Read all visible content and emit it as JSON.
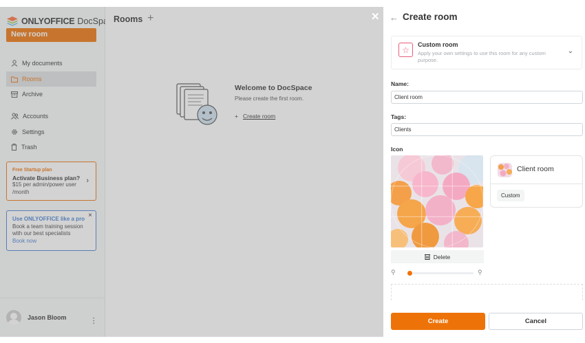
{
  "sidebar": {
    "logo": {
      "brand": "ONLYOFFICE",
      "product": "DocSpace"
    },
    "new_room_label": "New room",
    "items": [
      {
        "label": "My documents",
        "icon": "user-icon"
      },
      {
        "label": "Rooms",
        "icon": "folder-icon",
        "active": true
      },
      {
        "label": "Archive",
        "icon": "archive-icon"
      },
      {
        "label": "Accounts",
        "icon": "users-icon"
      },
      {
        "label": "Settings",
        "icon": "gear-icon"
      },
      {
        "label": "Trash",
        "icon": "trash-icon"
      }
    ],
    "promo_business": {
      "badge": "Free Startup plan",
      "title": "Activate Business plan?",
      "text": "$15 per admin/power user /month"
    },
    "promo_training": {
      "title": "Use ONLYOFFICE like a pro",
      "text": "Book a team training session with our best specialists",
      "link": "Book now"
    },
    "user": {
      "name": "Jason Bloom"
    }
  },
  "main": {
    "title": "Rooms",
    "empty": {
      "title": "Welcome to DocSpace",
      "subtitle": "Please create the first room.",
      "create_link": "Create room"
    }
  },
  "panel": {
    "title": "Create room",
    "room_type": {
      "name": "Custom room",
      "description": "Apply your own settings to use this room for any custom purpose."
    },
    "name_label": "Name:",
    "name_value": "Client room",
    "tags_label": "Tags:",
    "tags_value": "Clients",
    "icon_label": "Icon",
    "delete_label": "Delete",
    "zoom_level": 0.05,
    "preview": {
      "name": "Client room",
      "tag": "Custom"
    },
    "create_label": "Create",
    "cancel_label": "Cancel"
  },
  "colors": {
    "accent": "#ED7309",
    "link": "#4781D1",
    "custom_room": "#E85C7B"
  }
}
